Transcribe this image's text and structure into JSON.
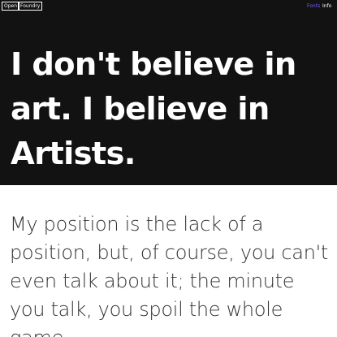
{
  "nav": {
    "logo_parts": [
      "Open",
      "Foundry"
    ],
    "links": [
      "Fonts",
      "Info"
    ]
  },
  "hero": {
    "quote": "I don't believe in art. I believe in Artists."
  },
  "body": {
    "quote": "My position is the lack of a position, but, of course, you can't even talk about it; the minute you talk, you spoil the whole game."
  },
  "colors": {
    "background_dark": "#121212",
    "text_light": "#ffffff",
    "text_body": "#333333",
    "accent": "#7a5cff"
  }
}
